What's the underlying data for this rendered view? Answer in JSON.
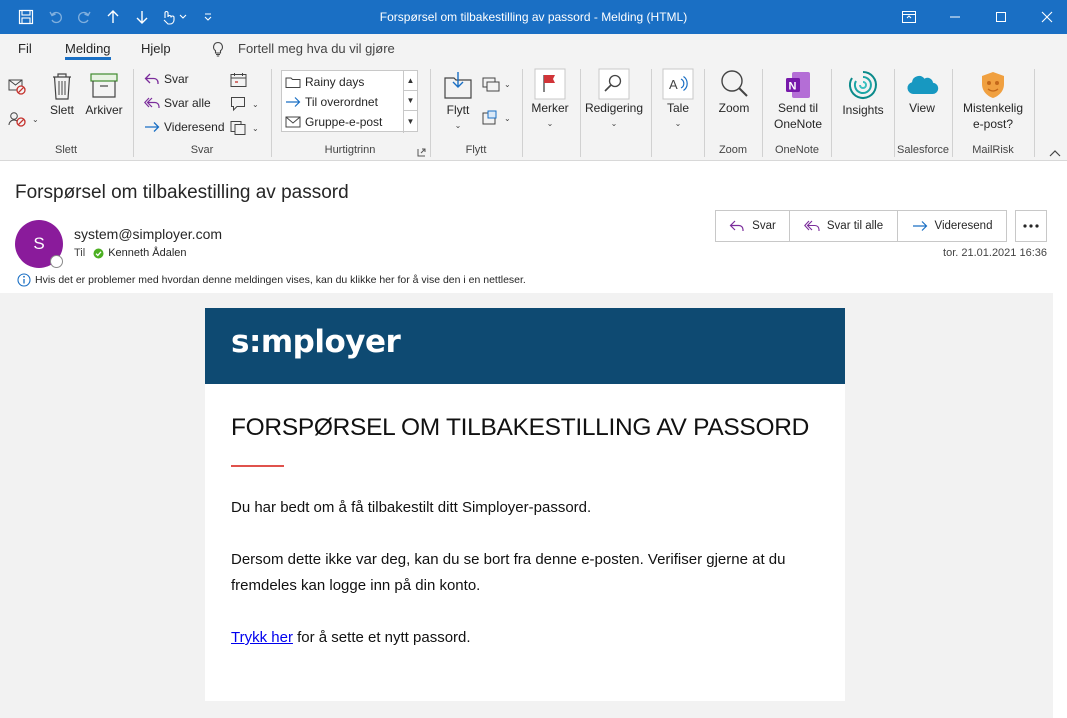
{
  "window": {
    "title": "Forspørsel om tilbakestilling av passord  -  Melding (HTML)"
  },
  "menu": {
    "tabs": [
      "Fil",
      "Melding",
      "Hjelp"
    ],
    "active_tab": "Melding",
    "tell_me": "Fortell meg hva du vil gjøre"
  },
  "ribbon": {
    "groups": {
      "slett": "Slett",
      "svar": "Svar",
      "hurtigtrinn": "Hurtigtrinn",
      "flytt": "Flytt",
      "zoom": "Zoom",
      "onenote": "OneNote",
      "salesforce": "Salesforce",
      "mailrisk": "MailRisk"
    },
    "buttons": {
      "slett": "Slett",
      "arkiver": "Arkiver",
      "svar": "Svar",
      "svar_alle": "Svar alle",
      "videresend": "Videresend",
      "flytt": "Flytt",
      "merker": "Merker",
      "redigering": "Redigering",
      "tale": "Tale",
      "zoom": "Zoom",
      "send_onenote_1": "Send til",
      "send_onenote_2": "OneNote",
      "insights": "Insights",
      "view": "View",
      "mistenkelig_1": "Mistenkelig",
      "mistenkelig_2": "e-post?"
    },
    "quick_steps": [
      "Rainy days",
      "Til overordnet",
      "Gruppe-e-post"
    ]
  },
  "message": {
    "subject": "Forspørsel om tilbakestilling av passord",
    "avatar_initial": "S",
    "sender": "system@simployer.com",
    "to_label": "Til",
    "recipient": "Kenneth Ådalen",
    "info": "Hvis det er problemer med hvordan denne meldingen vises, kan du klikke her for å vise den i en nettleser.",
    "datetime": "tor. 21.01.2021 16:36",
    "actions": {
      "reply": "Svar",
      "reply_all": "Svar til alle",
      "forward": "Videresend"
    }
  },
  "email": {
    "logo": "s:mployer",
    "heading": "FORSPØRSEL OM TILBAKESTILLING AV PASSORD",
    "para1": "Du har bedt om å få tilbakestilt ditt Simployer-passord.",
    "para2": "Dersom dette ikke var deg, kan du se bort fra denne e-posten. Verifiser gjerne at du fremdeles kan logge inn på din konto.",
    "link_text": "Trykk her",
    "para3_rest": " for å sette et nytt passord."
  },
  "colors": {
    "titlebar": "#1a6fc4",
    "accent": "#1a6fc4",
    "avatar": "#8a1b9b",
    "email_header": "#0e4a72",
    "redline": "#e0524c"
  }
}
